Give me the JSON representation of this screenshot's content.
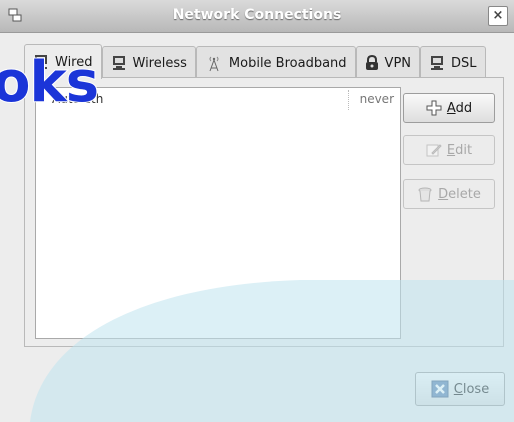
{
  "window": {
    "title": "Network Connections",
    "close_glyph": "×"
  },
  "tabs": [
    {
      "label": "Wired",
      "icon": "wired-icon",
      "active": true
    },
    {
      "label": "Wireless",
      "icon": "wireless-icon",
      "active": false
    },
    {
      "label": "Mobile Broadband",
      "icon": "antenna-icon",
      "active": false
    },
    {
      "label": "VPN",
      "icon": "lock-icon",
      "active": false
    },
    {
      "label": "DSL",
      "icon": "dsl-icon",
      "active": false
    }
  ],
  "connections": [
    {
      "name": "Auto eth",
      "last_used": "never"
    }
  ],
  "buttons": {
    "add": "Add",
    "edit": "Edit",
    "delete": "Delete",
    "close": "Close"
  },
  "watermark": {
    "text": "oks"
  },
  "colors": {
    "watermark": "#1b35d8",
    "overlay": "#bfe3ef"
  }
}
